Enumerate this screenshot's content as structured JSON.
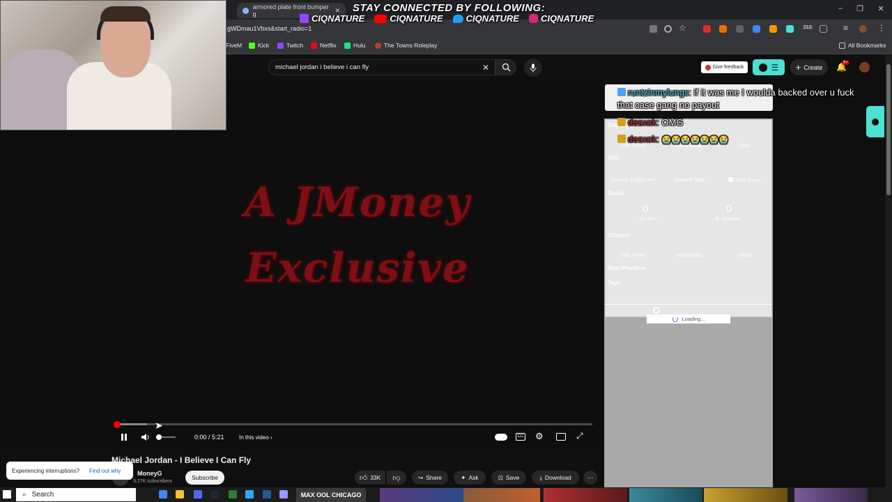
{
  "browser": {
    "tab_title": "armored plate front bumper g",
    "url": "gWDmau1Vbxs&start_radio=1",
    "bookmarks": [
      {
        "label": "FiveM",
        "color": "#f26522"
      },
      {
        "label": "Kick",
        "color": "#53fc18"
      },
      {
        "label": "Twitch",
        "color": "#9146ff"
      },
      {
        "label": "Netflix",
        "color": "#e50914"
      },
      {
        "label": "Hulu",
        "color": "#1ce783"
      },
      {
        "label": "The Towns Roleplay",
        "color": "#c0392b"
      }
    ],
    "all_bookmarks": "All Bookmarks",
    "ext_badge": "213"
  },
  "stream_overlay": {
    "heading": "STAY CONNECTED BY FOLLOWING:",
    "handles": [
      {
        "platform": "twitch-icon",
        "name": "CIQNATURE",
        "color": "#9146ff"
      },
      {
        "platform": "youtube-icon",
        "name": "CIQNATURE",
        "color": "#ff0000"
      },
      {
        "platform": "twitter-icon",
        "name": "CIQNATURE",
        "color": "#1da1f2"
      },
      {
        "platform": "instagram-icon",
        "name": "CIQNATURE",
        "color": "#d62976"
      }
    ]
  },
  "chat": [
    {
      "user": "runtzinmylungs:",
      "message": "if it was me I woulda backed over u fuck",
      "message2": "that case gang no payout"
    },
    {
      "user": "desxok:",
      "message": "OMG"
    },
    {
      "user": "desxok:",
      "message": "😭😭😭😭😭😭😭"
    }
  ],
  "youtube": {
    "search_query": "michael jordan i believe i can fly",
    "feedback_label": "Give feedback",
    "create_label": "Create",
    "notif_badge": "9+",
    "video_text_line1": "A JMoney",
    "video_text_line2": "Exclusive",
    "time": "0:00 / 5:21",
    "in_this_video": "In this video",
    "title": "Michael Jordan - I Believe I Can Fly",
    "channel": "MoneyG",
    "subscribers": "3.27K subscribers",
    "subscribe_label": "Subscribe",
    "likes": "33K",
    "share_label": "Share",
    "ask_label": "Ask",
    "save_label": "Save",
    "download_label": "Download",
    "interrupt_text": "Experiencing interruptions?",
    "interrupt_link": "Find out why",
    "progress_fraction": 0
  },
  "side_panel": {
    "summary_label": "Summary",
    "summary_cols": [
      "Total Views",
      "Comments",
      "Likes"
    ],
    "seo_label": "SEO",
    "seo_cols": [
      "Creator Suggested",
      "Ranked Tags",
      "SEO Score"
    ],
    "social_label": "Social",
    "social_likes_value": "0",
    "social_likes_label": "Likes",
    "social_upvotes_value": "0",
    "social_upvotes_label": "Upvotes",
    "channel_label": "Channel",
    "channel_cols": [
      "Total Views",
      "Subscribers",
      "Videos"
    ],
    "best_practices_label": "Best Practices",
    "tags_label": "Tags",
    "loading_label": "Loading..."
  },
  "taskbar": {
    "search_placeholder": "Search",
    "thumb_text": "MAX OOL CHICAGO"
  }
}
